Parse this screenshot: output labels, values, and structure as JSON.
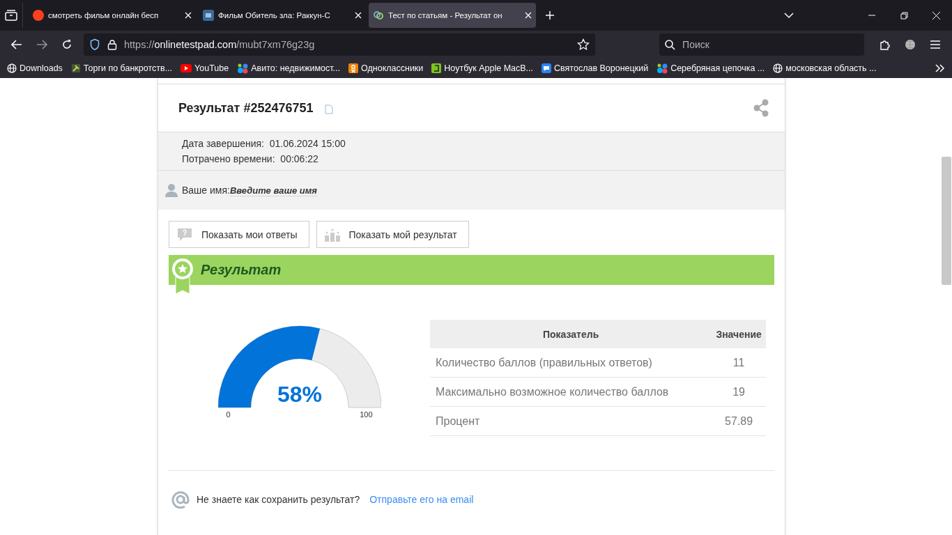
{
  "tabs": [
    {
      "title": "смотреть фильм онлайн бесп",
      "kind": "yandex",
      "selected": false
    },
    {
      "title": "Фильм Обитель зла: Раккун-С",
      "kind": "hd",
      "selected": false
    },
    {
      "title": "Тест по статьям - Результат он",
      "kind": "knot",
      "selected": true
    }
  ],
  "address": {
    "scheme": "https://",
    "host": "onlinetestpad.com",
    "path": "/mubt7xm76g23g"
  },
  "search": {
    "placeholder": "Поиск"
  },
  "bookmarks": [
    {
      "label": "Downloads",
      "kind": "globe"
    },
    {
      "label": "Торги по банкротств...",
      "kind": "gavel"
    },
    {
      "label": "YouTube",
      "kind": "youtube"
    },
    {
      "label": "Авито: недвижимост...",
      "kind": "dots"
    },
    {
      "label": "Одноклассники",
      "kind": "ok"
    },
    {
      "label": "Ноутбук Apple MacB...",
      "kind": "green"
    },
    {
      "label": "Святослав Воронецкий",
      "kind": "chat"
    },
    {
      "label": "Серебряная цепочка ...",
      "kind": "dots"
    },
    {
      "label": "московская область ...",
      "kind": "globe"
    }
  ],
  "result": {
    "title": "Результат #252476751",
    "info": [
      {
        "label": "Дата завершения:",
        "value": "01.06.2024 15:00"
      },
      {
        "label": "Потрачено времени:",
        "value": "00:06:22"
      }
    ],
    "name_label": "Ваше имя:",
    "name_placeholder": "Введите ваше имя",
    "buttons": [
      {
        "label": "Показать мои ответы",
        "kind": "question"
      },
      {
        "label": "Показать мой результат",
        "kind": "podium"
      }
    ],
    "section_title": "Результат",
    "gauge": {
      "level": 0.58,
      "reading": "58%",
      "min": "0",
      "max": "100"
    },
    "table": {
      "columns": [
        "Показатель",
        "Значение"
      ],
      "rows": [
        [
          "Количество баллов (правильных ответов)",
          "11"
        ],
        [
          "Максимально возможное количество баллов",
          "19"
        ],
        [
          "Процент",
          "57.89"
        ]
      ]
    },
    "save_question": "Не знаете как сохранить результат?",
    "save_link": "Отправьте его на email"
  }
}
